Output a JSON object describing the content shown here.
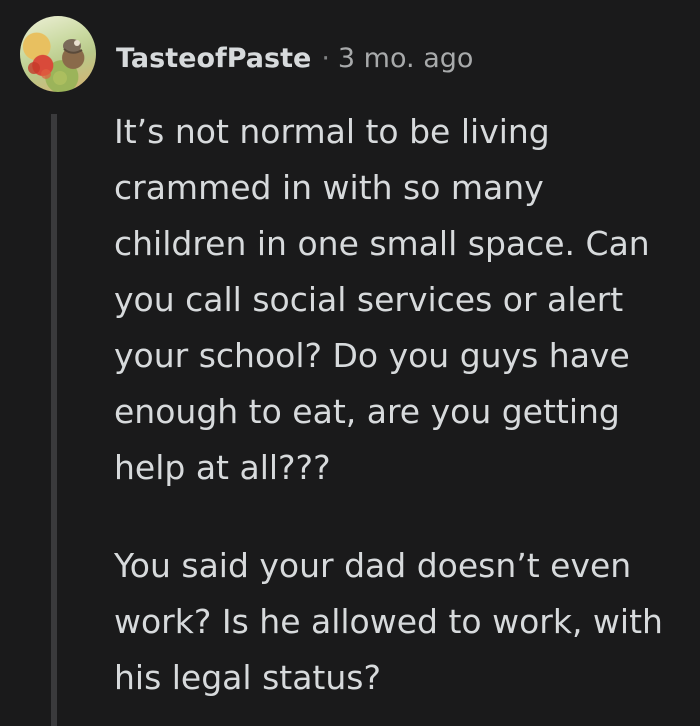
{
  "comment": {
    "username": "TasteofPaste",
    "separator": "·",
    "timestamp": "3 mo. ago",
    "avatar": "user-avatar-image",
    "paragraphs": [
      "It’s not normal to be living crammed in with so many children in one small space. Can you call social services or alert your school? Do you guys have enough to eat, are you getting help at all???",
      "You said your dad doesn’t even work? Is he allowed to work, with his legal status?"
    ]
  },
  "colors": {
    "background": "#1a1a1b",
    "text": "#d7dadc",
    "meta": "#a8aaab",
    "thread_line": "#3a3a3c"
  }
}
